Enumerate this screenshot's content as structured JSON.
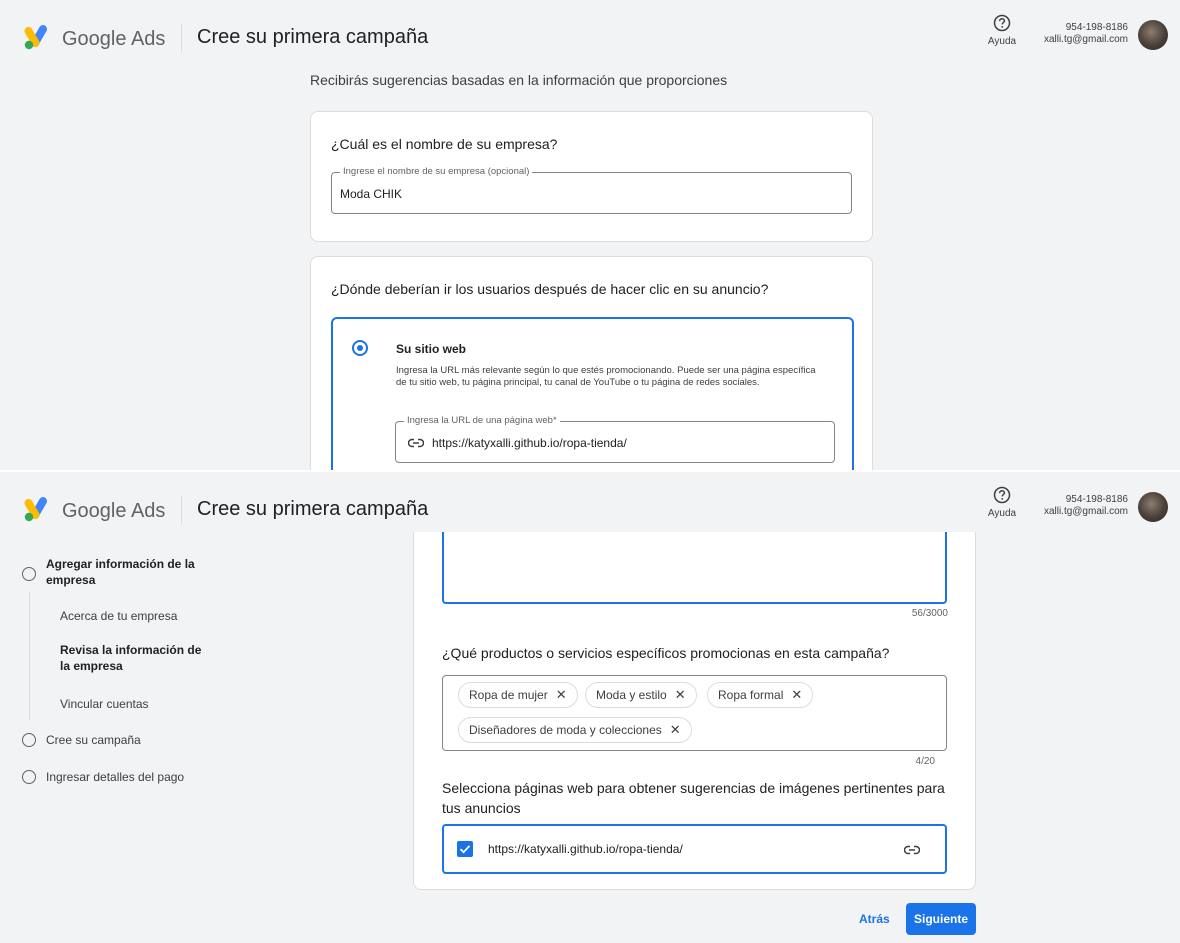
{
  "header": {
    "brand": "Google Ads",
    "title": "Cree su primera campaña",
    "help_label": "Ayuda",
    "account_phone": "954-198-8186",
    "account_email": "xalli.tg@gmail.com"
  },
  "top": {
    "subtitle": "Recibirás sugerencias basadas en la información que proporciones",
    "business_name": {
      "question": "¿Cuál es el nombre de su empresa?",
      "label": "Ingrese el nombre de su empresa (opcional)",
      "value": "Moda CHIK"
    },
    "destination": {
      "question": "¿Dónde deberían ir los usuarios después de hacer clic en su anuncio?",
      "option_title": "Su sitio web",
      "option_desc": "Ingresa la URL más relevante según lo que estés promocionando. Puede ser una página específica de tu sitio web, tu página principal, tu canal de YouTube o tu página de redes sociales.",
      "url_label": "Ingresa la URL de una página web*",
      "url_value": "https://katyxalli.github.io/ropa-tienda/"
    }
  },
  "stepper": {
    "step1": "Agregar información de la empresa",
    "sub1": "Acerca de tu empresa",
    "sub2": "Revisa la información de la empresa",
    "sub3": "Vincular cuentas",
    "step2": "Cree su campaña",
    "step3": "Ingresar detalles del pago"
  },
  "bottom": {
    "desc_counter": "56/3000",
    "products_question": "¿Qué productos o servicios específicos promocionas en esta campaña?",
    "chips": [
      "Ropa de mujer",
      "Moda y estilo",
      "Ropa formal",
      "Diseñadores de moda y colecciones"
    ],
    "chips_counter": "4/20",
    "pages_question": "Selecciona páginas web para obtener sugerencias de imágenes pertinentes para tus anuncios",
    "page_url": "https://katyxalli.github.io/ropa-tienda/",
    "back_label": "Atrás",
    "next_label": "Siguiente"
  },
  "colors": {
    "accent": "#1a73e8",
    "background": "#f1f3f4"
  }
}
